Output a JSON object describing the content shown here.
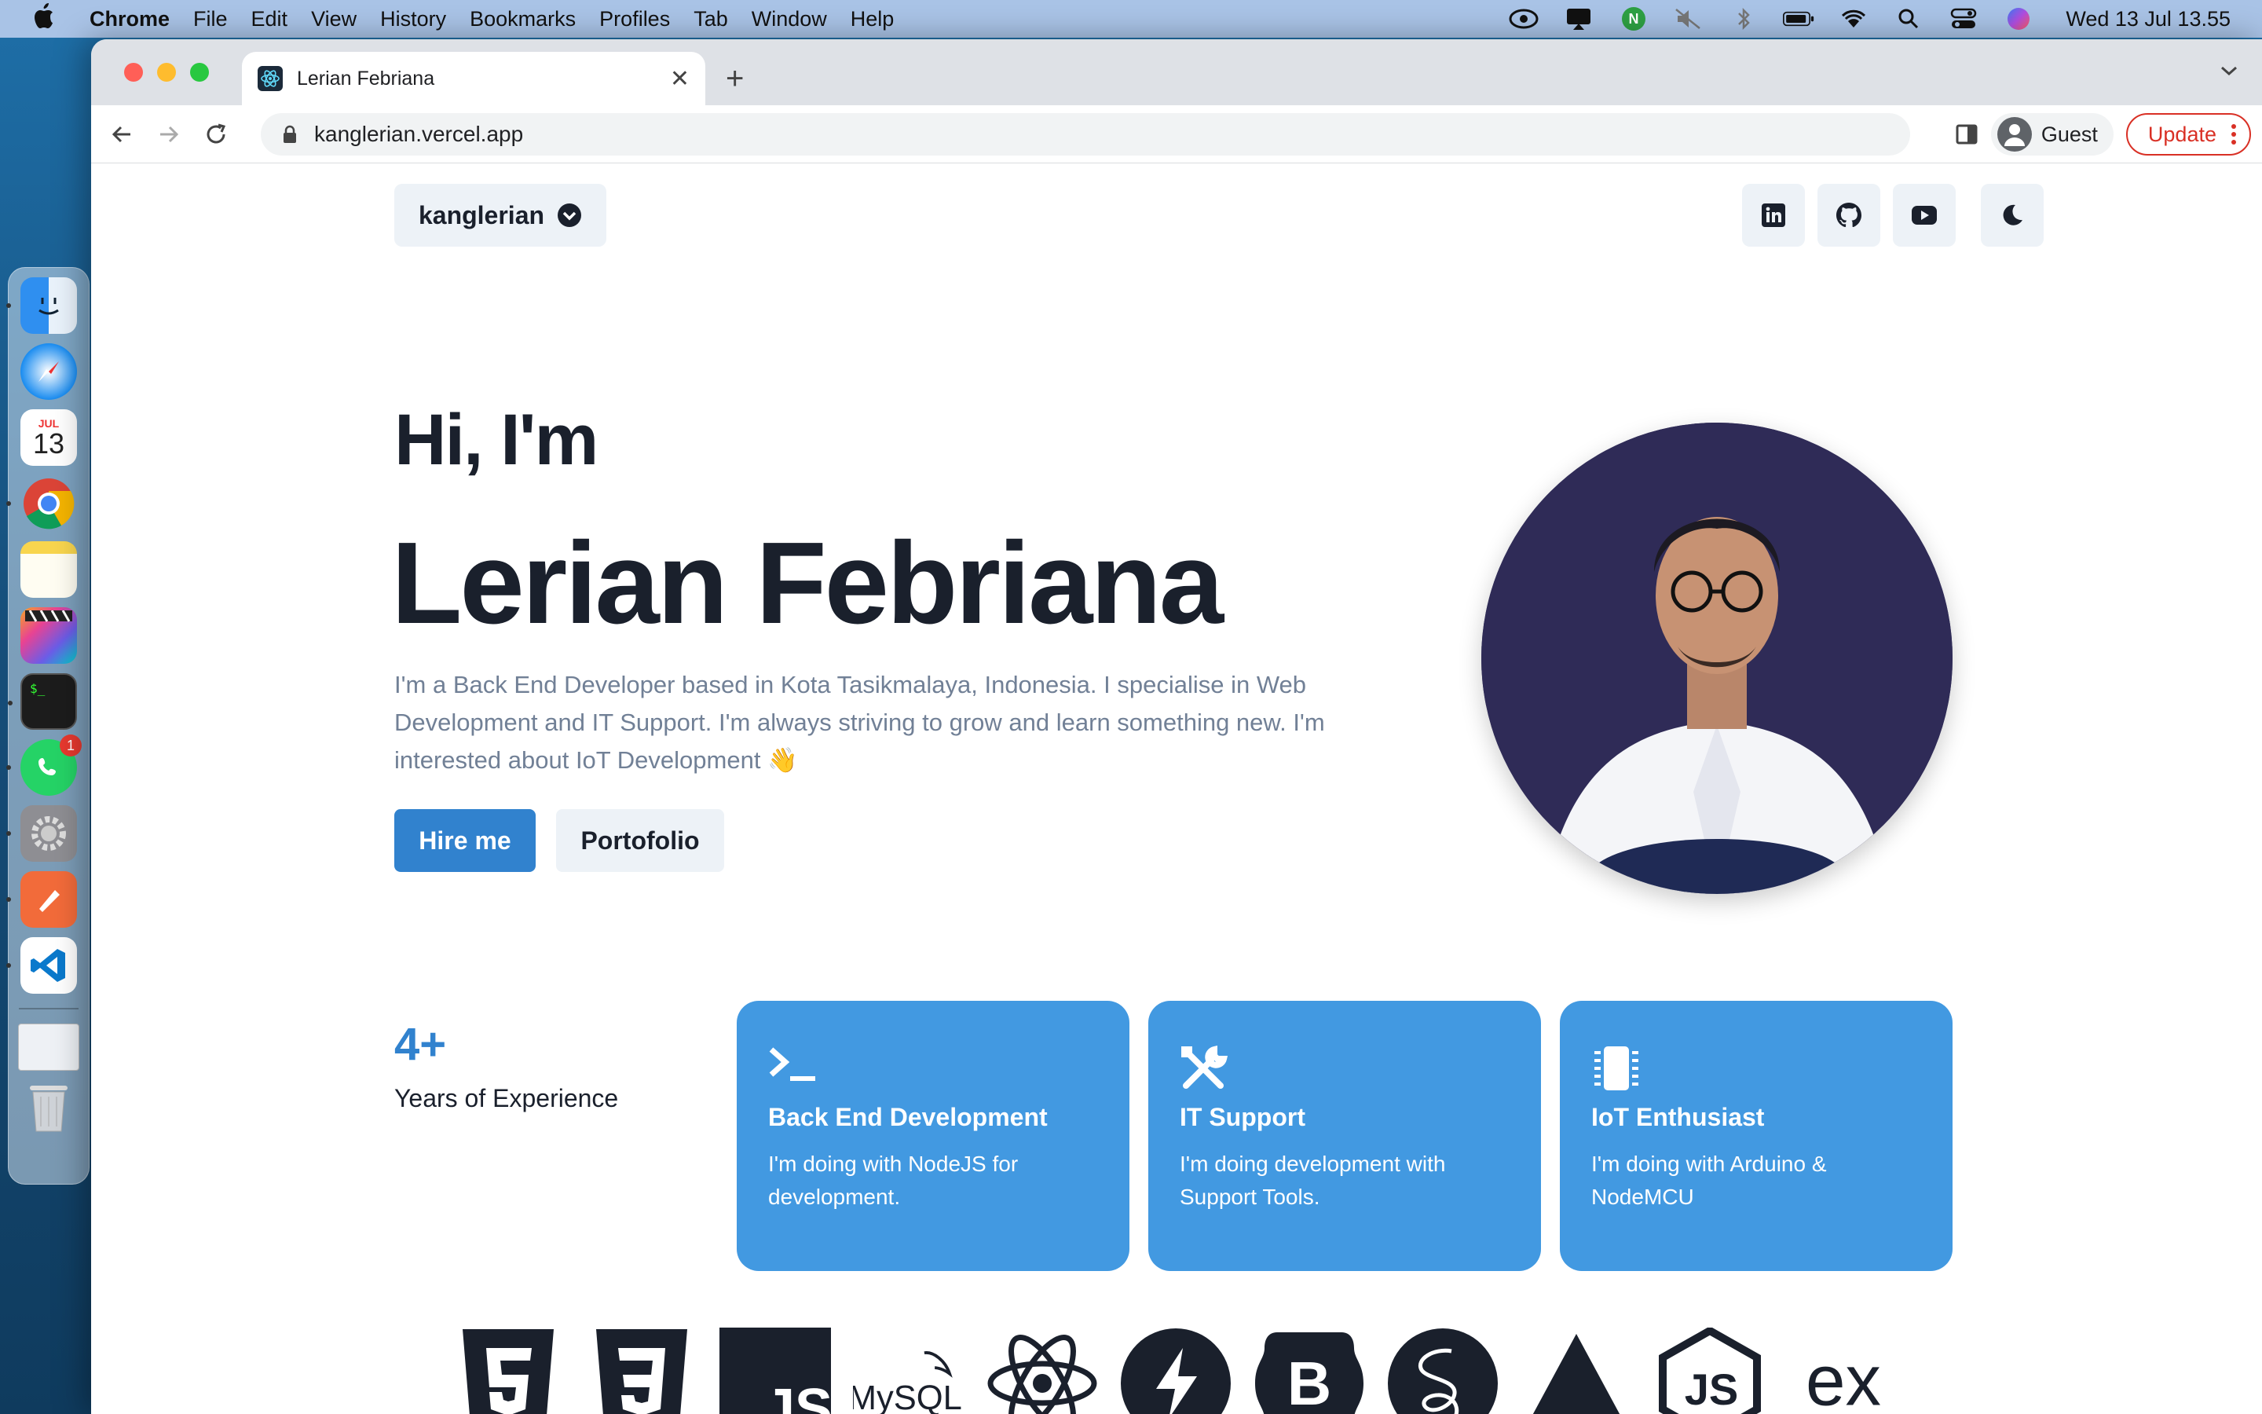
{
  "menubar": {
    "app_name": "Chrome",
    "menus": [
      "File",
      "Edit",
      "View",
      "History",
      "Bookmarks",
      "Profiles",
      "Tab",
      "Window",
      "Help"
    ],
    "clock": "Wed 13 Jul  13.55"
  },
  "dock": {
    "apps": [
      "finder",
      "safari",
      "calendar",
      "chrome",
      "notes",
      "final-cut-pro",
      "terminal",
      "whatsapp",
      "system-preferences",
      "pen-tool",
      "vscode",
      "preview",
      "trash"
    ],
    "calendar_month": "JUL",
    "calendar_day": "13",
    "whatsapp_badge": "1"
  },
  "browser": {
    "tab_title": "Lerian Febriana",
    "url": "kanglerian.vercel.app",
    "profile_label": "Guest",
    "update_label": "Update"
  },
  "page": {
    "brand": "kanglerian",
    "social_icons": [
      "linkedin-icon",
      "github-icon",
      "youtube-icon",
      "moon-icon"
    ],
    "greeting": "Hi, I'm",
    "name": "Lerian Febriana",
    "bio": "I'm a Back End Developer based in Kota Tasikmalaya, Indonesia. I specialise in Web Development and IT Support. I'm always striving to grow and learn something new. I'm interested about IoT Development 👋",
    "hire_label": "Hire me",
    "portfolio_label": "Portofolio",
    "experience_value": "4+",
    "experience_label": "Years of Experience",
    "cards": [
      {
        "title": "Back End Development",
        "text": "I'm doing with NodeJS for development.",
        "icon": "terminal-icon"
      },
      {
        "title": "IT Support",
        "text": "I'm doing development with Support Tools.",
        "icon": "tools-icon"
      },
      {
        "title": "IoT Enthusiast",
        "text": "I'm doing with Arduino & NodeMCU",
        "icon": "chip-icon"
      }
    ],
    "tech_logos": [
      "html5-logo",
      "css3-logo",
      "javascript-logo",
      "mysql-logo",
      "react-logo",
      "nextjs-logo",
      "bootstrap-logo",
      "sass-logo",
      "vercel-logo",
      "nodejs-logo",
      "express-logo"
    ],
    "tech_text": {
      "js": "JS",
      "mysql": "MySQL",
      "bootstrap": "B",
      "express": "ex"
    },
    "accent_color": "#3182ce",
    "card_color": "#4299e1"
  }
}
